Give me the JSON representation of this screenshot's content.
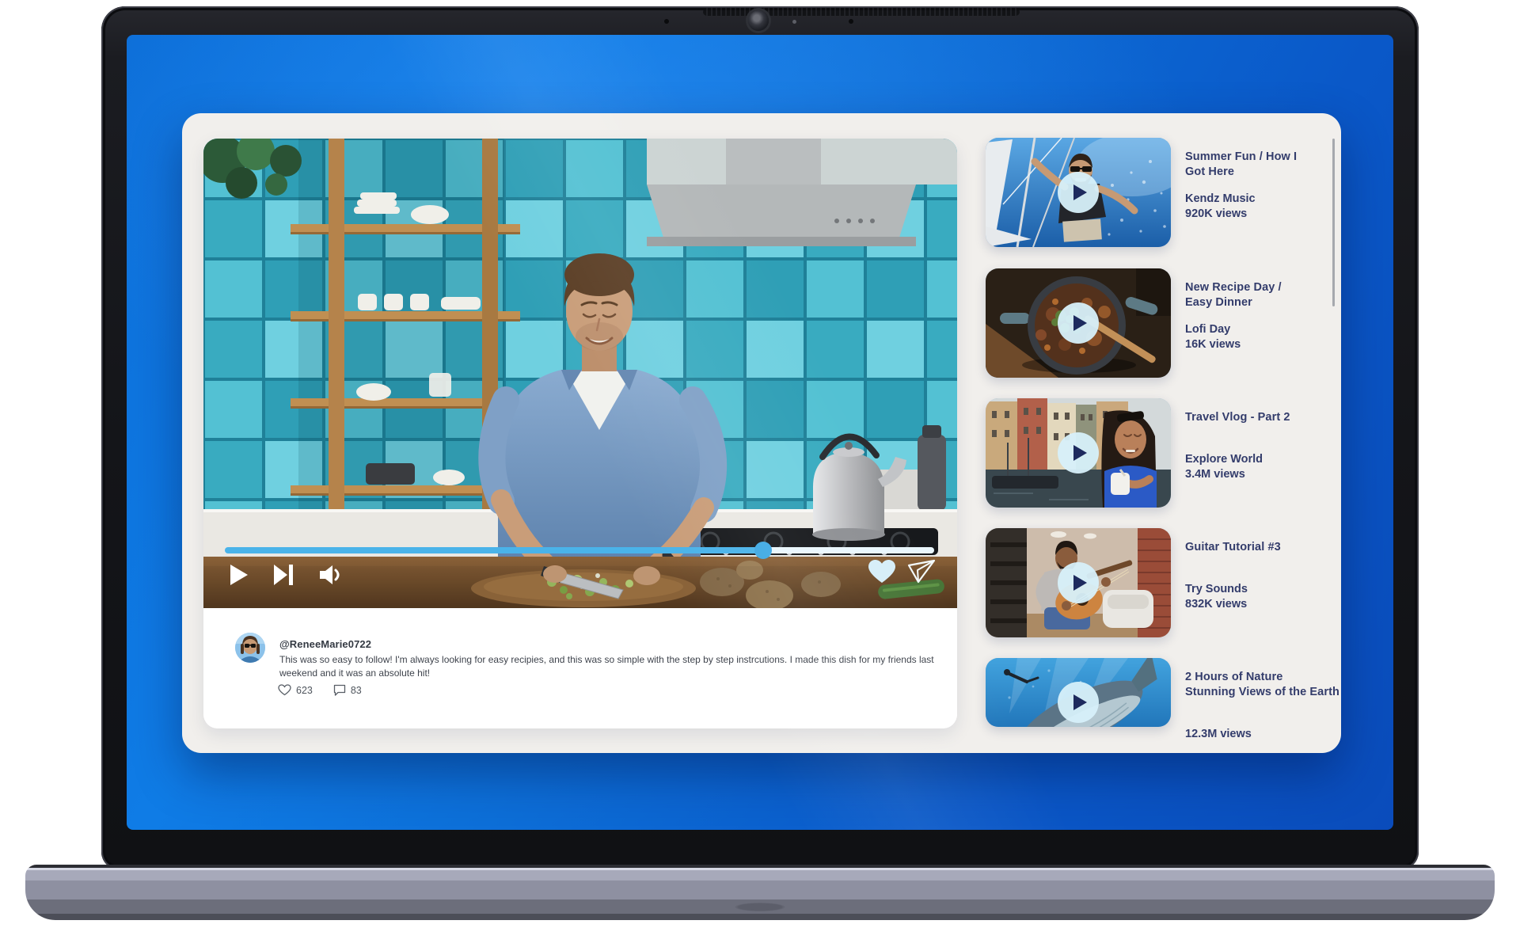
{
  "player": {
    "progress_percent": 76,
    "liked": true,
    "icons": {
      "play": "play-triangle",
      "next": "skip-next",
      "volume": "speaker-wave",
      "like": "heart-filled",
      "share": "paper-plane"
    }
  },
  "comment": {
    "username": "@ReneeMarie0722",
    "body": "This was so easy to follow! I'm always looking for easy recipies, and this was so simple with the step by step instrcutions. I made this dish for my friends last weekend and it was an absolute hit!",
    "like_count": "623",
    "reply_count": "83",
    "icons": {
      "like": "heart-outline",
      "replies": "speech-bubble-outline"
    }
  },
  "sidebar": {
    "items": [
      {
        "title_line1": "Summer Fun / How I",
        "title_line2": "Got Here",
        "channel": "Kendz Music",
        "views": "920K views"
      },
      {
        "title_line1": "New Recipe Day /",
        "title_line2": "Easy Dinner",
        "channel": "Lofi Day",
        "views": "16K views"
      },
      {
        "title_line1": "Travel Vlog - Part 2",
        "title_line2": "",
        "channel": "Explore World",
        "views": "3.4M views"
      },
      {
        "title_line1": "Guitar Tutorial #3",
        "title_line2": "",
        "channel": "Try Sounds",
        "views": "832K views"
      },
      {
        "title_line1": "2 Hours of Nature",
        "title_line2": "Stunning Views of the Earth",
        "channel": "",
        "views": "12.3M views"
      }
    ]
  },
  "colors": {
    "accent_progress": "#4ab3e9",
    "sidebar_text": "#333c6b",
    "desktop_blue_top": "#0e79e2",
    "desktop_blue_bottom": "#0a4fbe",
    "window_bg": "#f1efec"
  }
}
